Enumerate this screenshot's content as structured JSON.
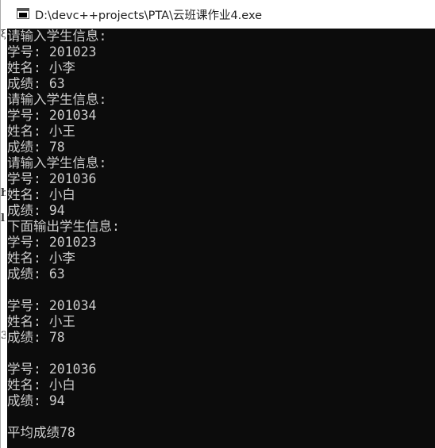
{
  "window": {
    "title": "D:\\devc++projects\\PTA\\云班课作业4.exe",
    "icon": "console-window-icon"
  },
  "console": {
    "lines": [
      "请输入学生信息:",
      "学号: 201023",
      "姓名: 小李",
      "成绩: 63",
      "请输入学生信息:",
      "学号: 201034",
      "姓名: 小王",
      "成绩: 78",
      "请输入学生信息:",
      "学号: 201036",
      "姓名: 小白",
      "成绩: 94",
      "下面输出学生信息:",
      "学号: 201023",
      "姓名: 小李",
      "成绩: 63",
      "",
      "学号: 201034",
      "姓名: 小王",
      "成绩: 78",
      "",
      "学号: 201036",
      "姓名: 小白",
      "成绩: 94",
      "",
      "平均成绩78"
    ]
  },
  "colors": {
    "console_background": "#0c0c0c",
    "console_text": "#cccccc",
    "titlebar_background": "#ffffff"
  }
}
